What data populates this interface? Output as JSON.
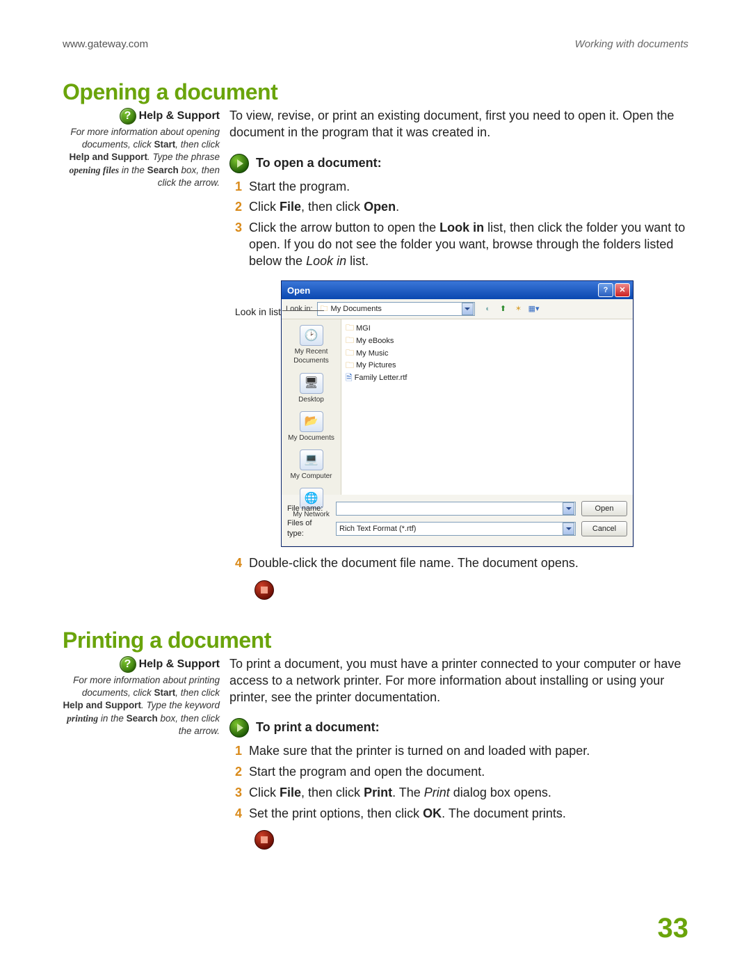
{
  "header": {
    "url": "www.gateway.com",
    "breadcrumb": "Working with documents"
  },
  "page_number": "33",
  "section1": {
    "title": "Opening a document",
    "help_title": "Help & Support",
    "help_body_1": "For more information about opening documents, click ",
    "help_b1": "Start",
    "help_mid1": ", then click ",
    "help_b2": "Help and Support",
    "help_mid2": ". Type the phrase ",
    "help_kw": "opening files",
    "help_mid3": " in the ",
    "help_b3": "Search",
    "help_end": " box, then click the arrow.",
    "intro": "To view, revise, or print an existing document, first you need to open it. Open the document in the program that it was created in.",
    "task": "To open a document:",
    "steps": {
      "s1": "Start the program.",
      "s2a": "Click ",
      "s2b": "File",
      "s2c": ", then click ",
      "s2d": "Open",
      "s2e": ".",
      "s3a": "Click the arrow button to open the ",
      "s3b": "Look in",
      "s3c": " list, then click the folder you want to open. If you do not see the folder you want, browse through the folders listed below the ",
      "s3d": "Look in",
      "s3e": " list.",
      "s4": "Double-click the document file name. The document opens."
    },
    "lookin_label": "Look in list"
  },
  "dialog": {
    "title": "Open",
    "lookin_label": "Look in:",
    "lookin_value": "My Documents",
    "places": {
      "p1": "My Recent Documents",
      "p2": "Desktop",
      "p3": "My Documents",
      "p4": "My Computer",
      "p5": "My Network"
    },
    "files": {
      "f1": "MGI",
      "f2": "My eBooks",
      "f3": "My Music",
      "f4": "My Pictures",
      "f5": "Family Letter.rtf"
    },
    "fname_label": "File name:",
    "fname_value": "",
    "ftype_label": "Files of type:",
    "ftype_value": "Rich Text Format (*.rtf)",
    "open_btn": "Open",
    "cancel_btn": "Cancel"
  },
  "section2": {
    "title": "Printing a document",
    "help_title": "Help & Support",
    "help_body_1": "For more information about printing documents, click ",
    "help_b1": "Start",
    "help_mid1": ", then click ",
    "help_b2": "Help and Support",
    "help_mid2": ". Type the keyword ",
    "help_kw": "printing",
    "help_mid3": " in the ",
    "help_b3": "Search",
    "help_end": " box, then click the arrow.",
    "intro": "To print a document, you must have a printer connected to your computer or have access to a network printer. For more information about installing or using your printer, see the printer documentation.",
    "task": "To print a document:",
    "steps": {
      "s1": "Make sure that the printer is turned on and loaded with paper.",
      "s2": "Start the program and open the document.",
      "s3a": "Click ",
      "s3b": "File",
      "s3c": ", then click ",
      "s3d": "Print",
      "s3e": ". The ",
      "s3f": "Print",
      "s3g": " dialog box opens.",
      "s4a": "Set the print options, then click ",
      "s4b": "OK",
      "s4c": ". The document prints."
    }
  }
}
